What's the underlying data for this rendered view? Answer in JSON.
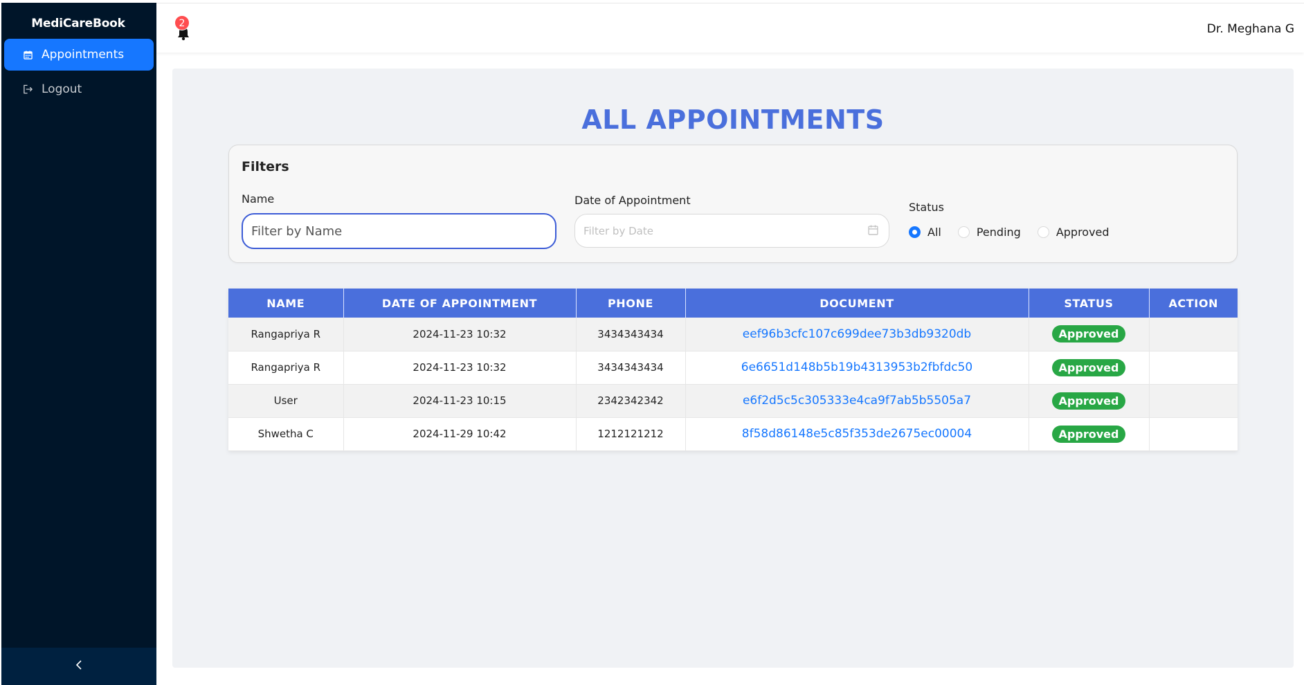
{
  "app": {
    "brand": "MediCareBook"
  },
  "sidebar": {
    "items": [
      {
        "label": "Appointments",
        "icon": "calendar-icon",
        "active": true
      },
      {
        "label": "Logout",
        "icon": "logout-icon",
        "active": false
      }
    ],
    "collapse_icon": "chevron-left-icon"
  },
  "header": {
    "notification_count": "2",
    "user_name": "Dr. Meghana G"
  },
  "page": {
    "title": "ALL APPOINTMENTS"
  },
  "filters": {
    "title": "Filters",
    "name_label": "Name",
    "name_placeholder": "Filter by Name",
    "date_label": "Date of Appointment",
    "date_placeholder": "Filter by Date",
    "status_label": "Status",
    "status_options": [
      "All",
      "Pending",
      "Approved"
    ],
    "status_selected": "All"
  },
  "table": {
    "columns": [
      "NAME",
      "DATE OF APPOINTMENT",
      "PHONE",
      "DOCUMENT",
      "STATUS",
      "ACTION"
    ],
    "rows": [
      {
        "name": "Rangapriya R",
        "date": "2024-11-23 10:32",
        "phone": "3434343434",
        "document": "eef96b3cfc107c699dee73b3db9320db",
        "status": "Approved",
        "action": ""
      },
      {
        "name": "Rangapriya R",
        "date": "2024-11-23 10:32",
        "phone": "3434343434",
        "document": "6e6651d148b5b19b4313953b2fbfdc50",
        "status": "Approved",
        "action": ""
      },
      {
        "name": "User",
        "date": "2024-11-23 10:15",
        "phone": "2342342342",
        "document": "e6f2d5c5c305333e4ca9f7ab5b5505a7",
        "status": "Approved",
        "action": ""
      },
      {
        "name": "Shwetha C",
        "date": "2024-11-29 10:42",
        "phone": "1212121212",
        "document": "8f58d86148e5c85f353de2675ec00004",
        "status": "Approved",
        "action": ""
      }
    ]
  },
  "colors": {
    "sidebar_bg": "#001529",
    "active_menu": "#1677ff",
    "title_blue": "#4a6fdc",
    "table_header": "#4a6fdc",
    "status_green": "#28a745",
    "link_blue": "#1677ff",
    "badge_red": "#ff4d4f"
  }
}
